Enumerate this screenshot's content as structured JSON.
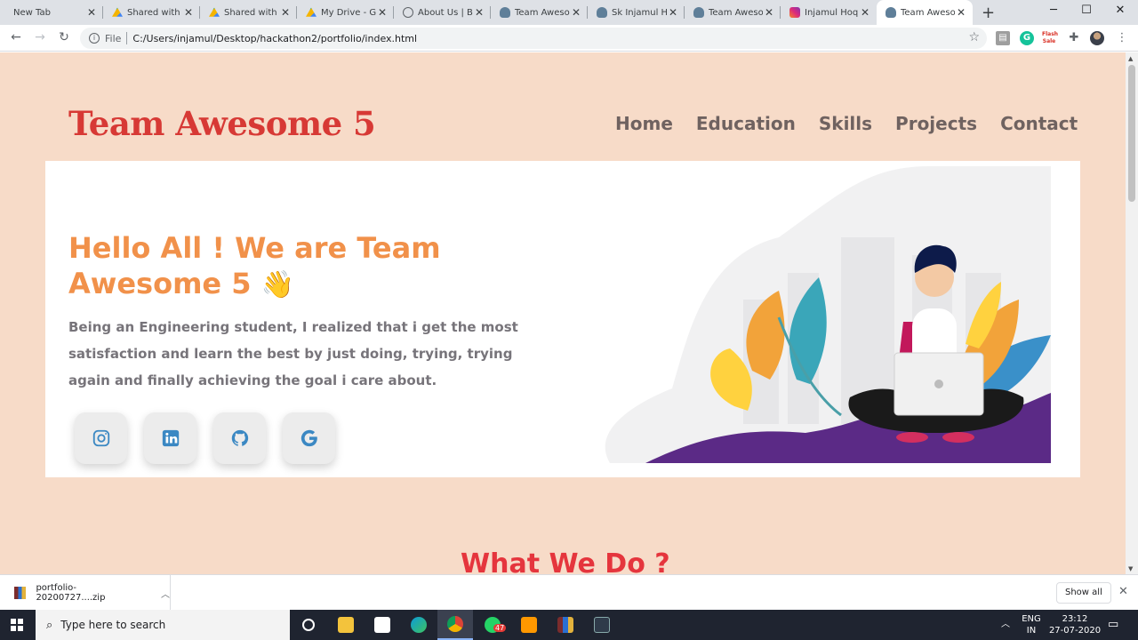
{
  "browser": {
    "tabs": [
      {
        "title": "New Tab",
        "icon": "none",
        "active": false
      },
      {
        "title": "Shared with",
        "icon": "google-drive",
        "active": false
      },
      {
        "title": "Shared with",
        "icon": "google-drive",
        "active": false
      },
      {
        "title": "My Drive - G",
        "icon": "google-drive",
        "active": false
      },
      {
        "title": "About Us | B",
        "icon": "about",
        "active": false
      },
      {
        "title": "Team Aweso",
        "icon": "person",
        "active": false
      },
      {
        "title": "Sk Injamul H",
        "icon": "person",
        "active": false
      },
      {
        "title": "Team Aweso",
        "icon": "person",
        "active": false
      },
      {
        "title": "Injamul Hoq",
        "icon": "instagram",
        "active": false
      },
      {
        "title": "Team Aweso",
        "icon": "person",
        "active": true
      }
    ],
    "address": {
      "scheme": "File",
      "url": "C:/Users/injamul/Desktop/hackathon2/portfolio/index.html"
    },
    "extensions": {
      "flash_label": "Flash Sale"
    }
  },
  "page": {
    "logo": "Team Awesome 5",
    "nav": [
      "Home",
      "Education",
      "Skills",
      "Projects",
      "Contact"
    ],
    "hero": {
      "title": "Hello All ! We are Team Awesome 5",
      "wave_emoji": "👋",
      "text": "Being an Engineering student, I realized that i get the most satisfaction and learn the best by just doing, trying, trying again and finally achieving the goal i care about."
    },
    "socials": [
      {
        "name": "instagram-icon"
      },
      {
        "name": "linkedin-icon"
      },
      {
        "name": "github-icon"
      },
      {
        "name": "google-icon"
      }
    ],
    "section_heading": "What We Do ?",
    "colors": {
      "background": "#f7dbc8",
      "logo": "#d73935",
      "hero_title": "#f1914a",
      "section_heading": "#e5353d",
      "nav": "#6f6260",
      "social_icons": "#3b88c3"
    }
  },
  "download_bar": {
    "file_name": "portfolio-20200727....zip",
    "show_all_label": "Show all"
  },
  "taskbar": {
    "search_placeholder": "Type here to search",
    "whatsapp_badge": "47",
    "language_line1": "ENG",
    "language_line2": "IN",
    "time": "23:12",
    "date": "27-07-2020"
  }
}
